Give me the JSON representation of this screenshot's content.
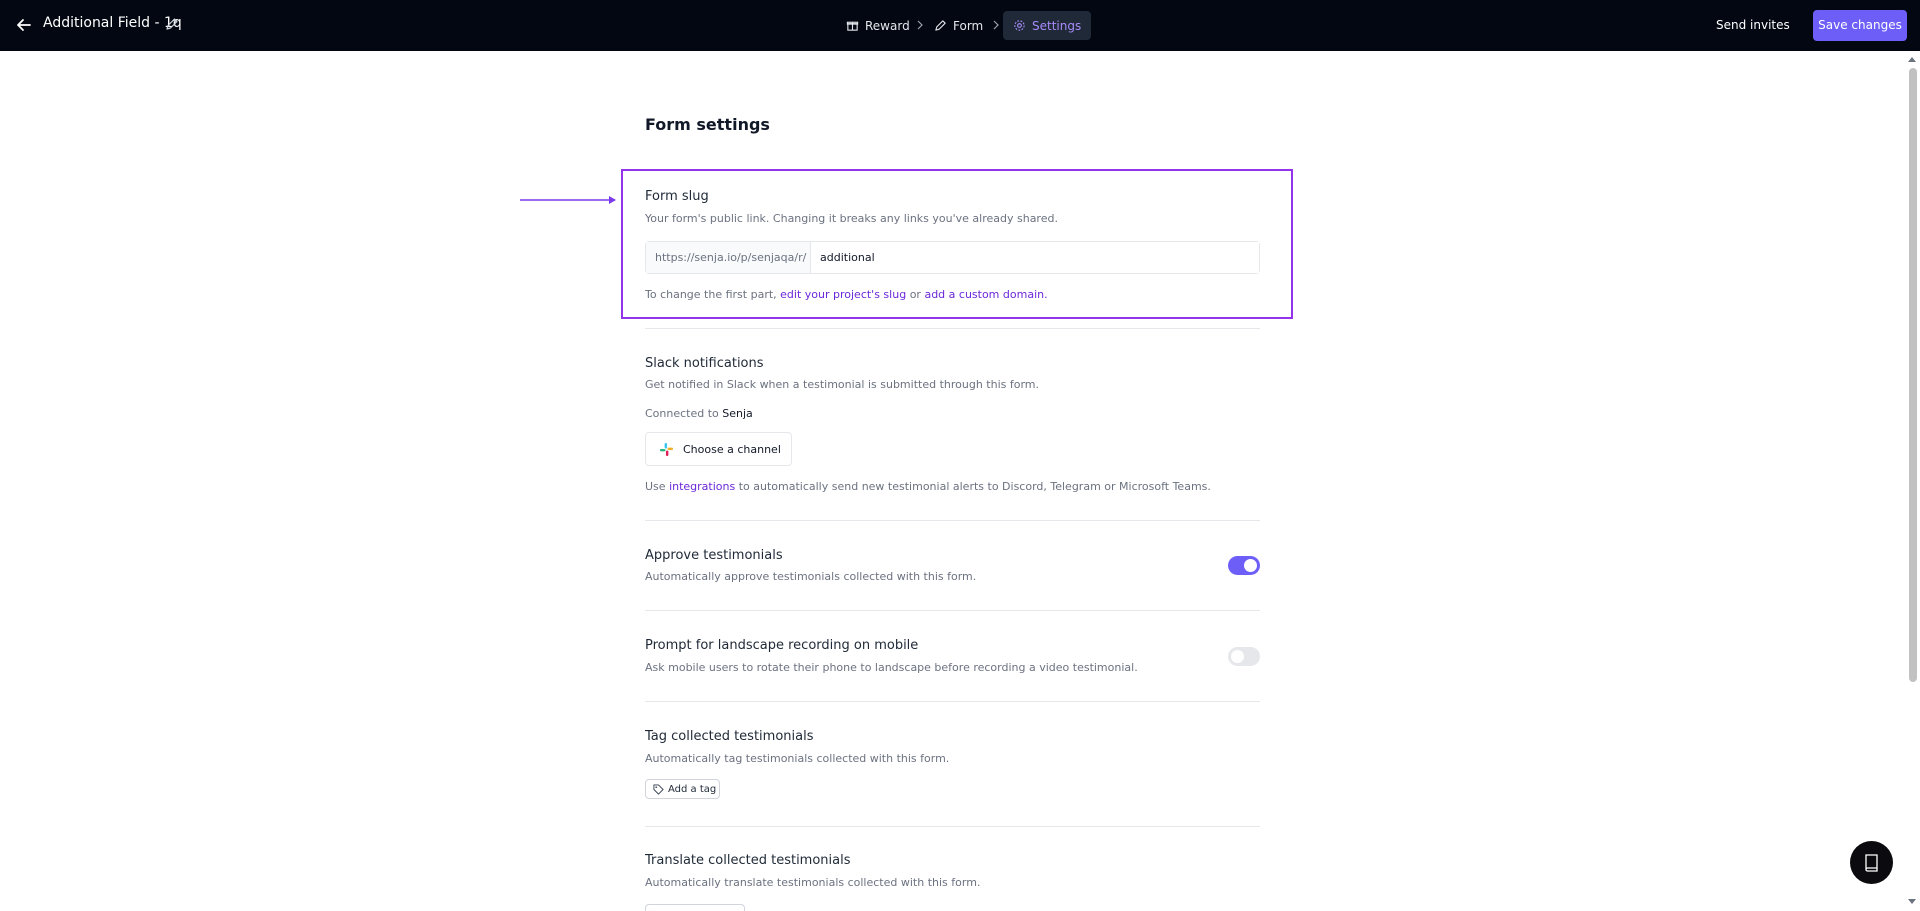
{
  "header": {
    "title": "Additional Field - 1q",
    "steps": [
      {
        "label": "Reward",
        "icon": "gift-icon"
      },
      {
        "label": "Form",
        "icon": "pen-icon"
      },
      {
        "label": "Settings",
        "icon": "gear-icon",
        "active": true
      }
    ],
    "send_invites": "Send invites",
    "save_changes": "Save changes"
  },
  "page": {
    "heading": "Form settings"
  },
  "form_slug": {
    "title": "Form slug",
    "description": "Your form's public link. Changing it breaks any links you've already shared.",
    "prefix": "https://senja.io/p/senjaqa/r/",
    "value": "additional",
    "help_prefix": "To change the first part,",
    "link_project_slug": "edit your project's slug",
    "help_or": "or",
    "link_custom_domain": "add a custom domain."
  },
  "slack": {
    "title": "Slack notifications",
    "description": "Get notified in Slack when a testimonial is submitted through this form.",
    "connected_prefix": "Connected to",
    "connected_workspace": "Senja",
    "channel_button": "Choose a channel",
    "use_prefix": "Use",
    "integrations_link": "integrations",
    "use_suffix": "to automatically send new testimonial alerts to Discord, Telegram or Microsoft Teams."
  },
  "approve": {
    "title": "Approve testimonials",
    "description": "Automatically approve testimonials collected with this form.",
    "enabled": true
  },
  "landscape": {
    "title": "Prompt for landscape recording on mobile",
    "description": "Ask mobile users to rotate their phone to landscape before recording a video testimonial.",
    "enabled": false
  },
  "tags": {
    "title": "Tag collected testimonials",
    "description": "Automatically tag testimonials collected with this form.",
    "add_tag": "Add a tag"
  },
  "translate": {
    "title": "Translate collected testimonials",
    "description": "Automatically translate testimonials collected with this form."
  },
  "colors": {
    "topbar": "#030712",
    "accent": "#6d5ef8",
    "highlight": "#9333ea",
    "link": "#6d28d9"
  }
}
